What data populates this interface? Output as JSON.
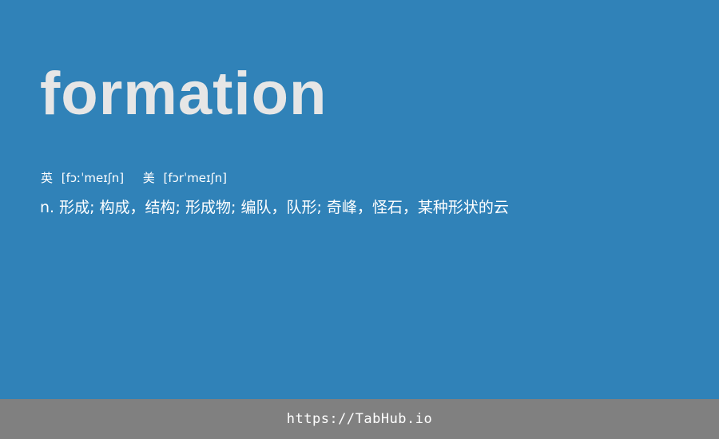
{
  "card": {
    "word": "formation",
    "phonetics": {
      "uk_label": "英",
      "uk_ipa": "[fɔːˈmeɪʃn]",
      "us_label": "美",
      "us_ipa": "[fɔrˈmeɪʃn]"
    },
    "definition": "n. 形成; 构成，结构; 形成物; 编队，队形; 奇峰，怪石，某种形状的云"
  },
  "footer": {
    "url": "https://TabHub.io"
  },
  "colors": {
    "background": "#3082b8",
    "word": "#e6e6e6",
    "text": "#ffffff",
    "footer_bg": "#808080"
  }
}
